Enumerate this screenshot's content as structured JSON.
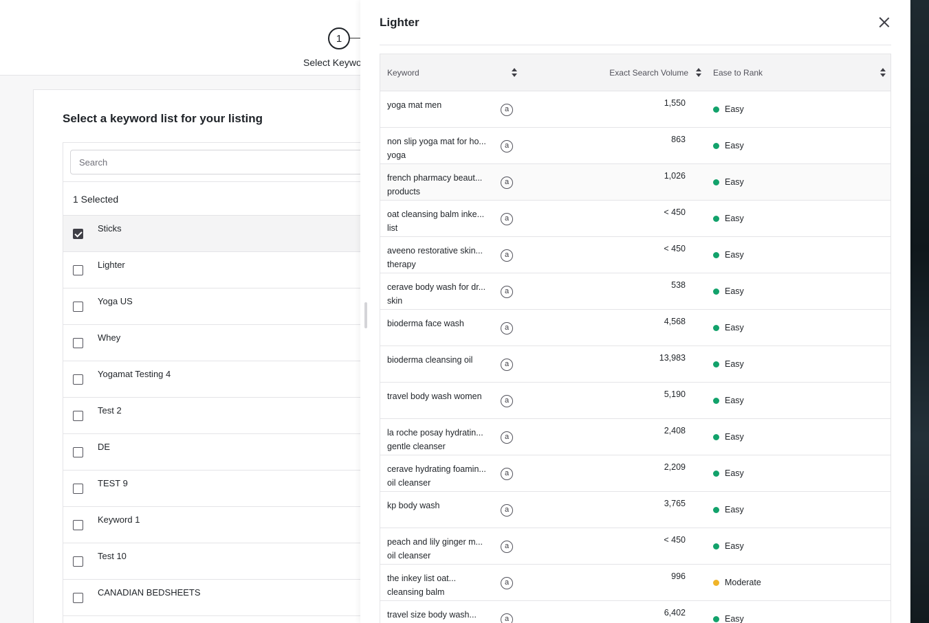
{
  "stepper": {
    "number": "1",
    "label": "Select Keywo"
  },
  "list_card": {
    "title": "Select a keyword list for your listing",
    "search_placeholder": "Search",
    "selected_count": "1 Selected",
    "items": [
      {
        "name": "Sticks",
        "checked": true
      },
      {
        "name": "Lighter",
        "checked": false
      },
      {
        "name": "Yoga US",
        "checked": false
      },
      {
        "name": "Whey",
        "checked": false
      },
      {
        "name": "Yogamat Testing 4",
        "checked": false
      },
      {
        "name": "Test 2",
        "checked": false
      },
      {
        "name": "DE",
        "checked": false
      },
      {
        "name": "TEST 9",
        "checked": false
      },
      {
        "name": "Keyword 1",
        "checked": false
      },
      {
        "name": "Test 10",
        "checked": false
      },
      {
        "name": "CANADIAN BEDSHEETS",
        "checked": false
      }
    ]
  },
  "drawer": {
    "title": "Lighter",
    "close_icon": "close-icon",
    "columns": {
      "keyword": "Keyword",
      "volume": "Exact Search Volume",
      "ease": "Ease to Rank"
    },
    "ease_colors": {
      "Easy": "#12a26b",
      "Moderate": "#f0b429"
    },
    "amazon_icon_glyph": "a",
    "rows": [
      {
        "kw1": "yoga mat men",
        "kw2": "",
        "volume": "1,550",
        "ease": "Easy"
      },
      {
        "kw1": "non slip yoga mat for ho...",
        "kw2": "yoga",
        "volume": "863",
        "ease": "Easy"
      },
      {
        "kw1": "french pharmacy beaut...",
        "kw2": "products",
        "volume": "1,026",
        "ease": "Easy"
      },
      {
        "kw1": "oat cleansing balm inke...",
        "kw2": "list",
        "volume": "< 450",
        "ease": "Easy"
      },
      {
        "kw1": "aveeno restorative skin...",
        "kw2": "therapy",
        "volume": "< 450",
        "ease": "Easy"
      },
      {
        "kw1": "cerave body wash for dr...",
        "kw2": "skin",
        "volume": "538",
        "ease": "Easy"
      },
      {
        "kw1": "bioderma face wash",
        "kw2": "",
        "volume": "4,568",
        "ease": "Easy"
      },
      {
        "kw1": "bioderma cleansing oil",
        "kw2": "",
        "volume": "13,983",
        "ease": "Easy"
      },
      {
        "kw1": "travel body wash women",
        "kw2": "",
        "volume": "5,190",
        "ease": "Easy"
      },
      {
        "kw1": "la roche posay hydratin...",
        "kw2": "gentle cleanser",
        "volume": "2,408",
        "ease": "Easy"
      },
      {
        "kw1": "cerave hydrating foamin...",
        "kw2": "oil cleanser",
        "volume": "2,209",
        "ease": "Easy"
      },
      {
        "kw1": "kp body wash",
        "kw2": "",
        "volume": "3,765",
        "ease": "Easy"
      },
      {
        "kw1": "peach and lily ginger m...",
        "kw2": "oil cleanser",
        "volume": "< 450",
        "ease": "Easy"
      },
      {
        "kw1": "the inkey list oat...",
        "kw2": "cleansing balm",
        "volume": "996",
        "ease": "Moderate"
      },
      {
        "kw1": "travel size body wash...",
        "kw2": "",
        "volume": "6,402",
        "ease": "Easy"
      }
    ]
  }
}
